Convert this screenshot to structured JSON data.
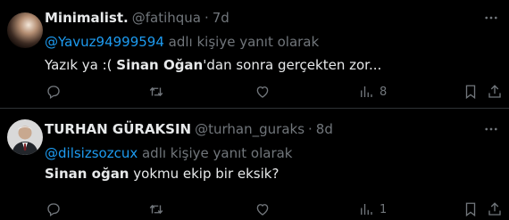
{
  "tweets": [
    {
      "name": "Minimalist.",
      "handle": "@fatihqua",
      "dot": "·",
      "time": "7d",
      "reply_to": "@Yavuz94999594",
      "reply_suffix": " adlı kişiye yanıt olarak",
      "text_parts": [
        "Yazık ya :( ",
        "Sinan Oğan",
        "'dan sonra gerçekten zor..."
      ],
      "views": "8",
      "replies": "",
      "retweets": "",
      "likes": ""
    },
    {
      "name": "TURHAN GÜRAKSIN",
      "handle": "@turhan_guraks",
      "dot": "·",
      "time": "8d",
      "reply_to": "@dilsizsozcux",
      "reply_suffix": " adlı kişiye yanıt olarak",
      "text_parts": [
        "Sinan oğan",
        " yokmu ekip bir eksik?"
      ],
      "views": "1",
      "replies": "",
      "retweets": "",
      "likes": ""
    }
  ],
  "colors": {
    "accent": "#1d9bf0",
    "muted": "#71767b",
    "text": "#e7e9ea",
    "bg": "#000000"
  },
  "icons": [
    "reply-icon",
    "retweet-icon",
    "like-icon",
    "views-icon",
    "bookmark-icon",
    "share-icon",
    "more-icon"
  ]
}
